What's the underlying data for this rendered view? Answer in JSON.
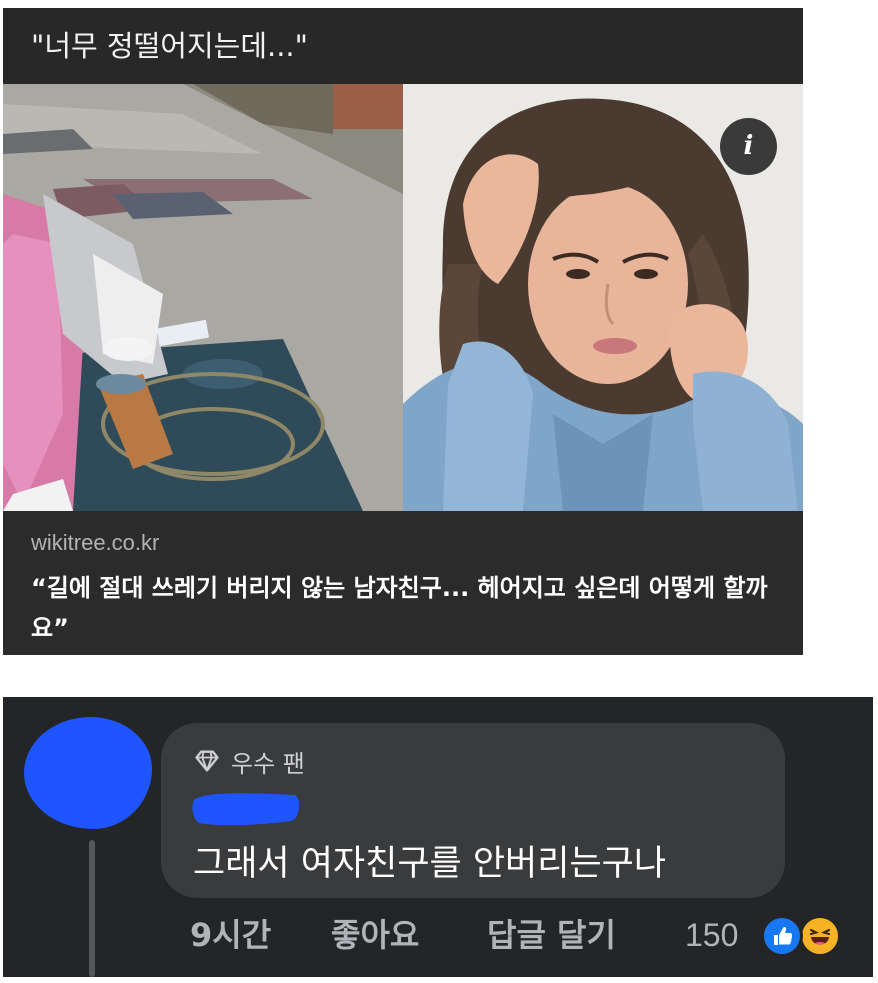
{
  "preview": {
    "title": "\"너무 정떨어지는데...\"",
    "info_icon": "i",
    "source_domain": "wikitree.co.kr",
    "headline": "“길에 절대 쓰레기 버리지 않는 남자친구... 헤어지고 싶은데 어떻게 할까요”"
  },
  "comment": {
    "badge_icon": "diamond-icon",
    "badge_label": "우수 팬",
    "text": "그래서 여자친구를 안버리는구나",
    "time": "9시간",
    "like_label": "좋아요",
    "reply_label": "답글 달기",
    "reaction_count": "150",
    "reactions": [
      "like",
      "haha"
    ]
  },
  "colors": {
    "card_bg": "#2b2b2b",
    "panel_bg": "#242526",
    "bubble_bg": "#3a3b3c",
    "redaction_blue": "#1f55ff",
    "like_blue": "#1877f2",
    "haha_yellow": "#f7b125"
  }
}
